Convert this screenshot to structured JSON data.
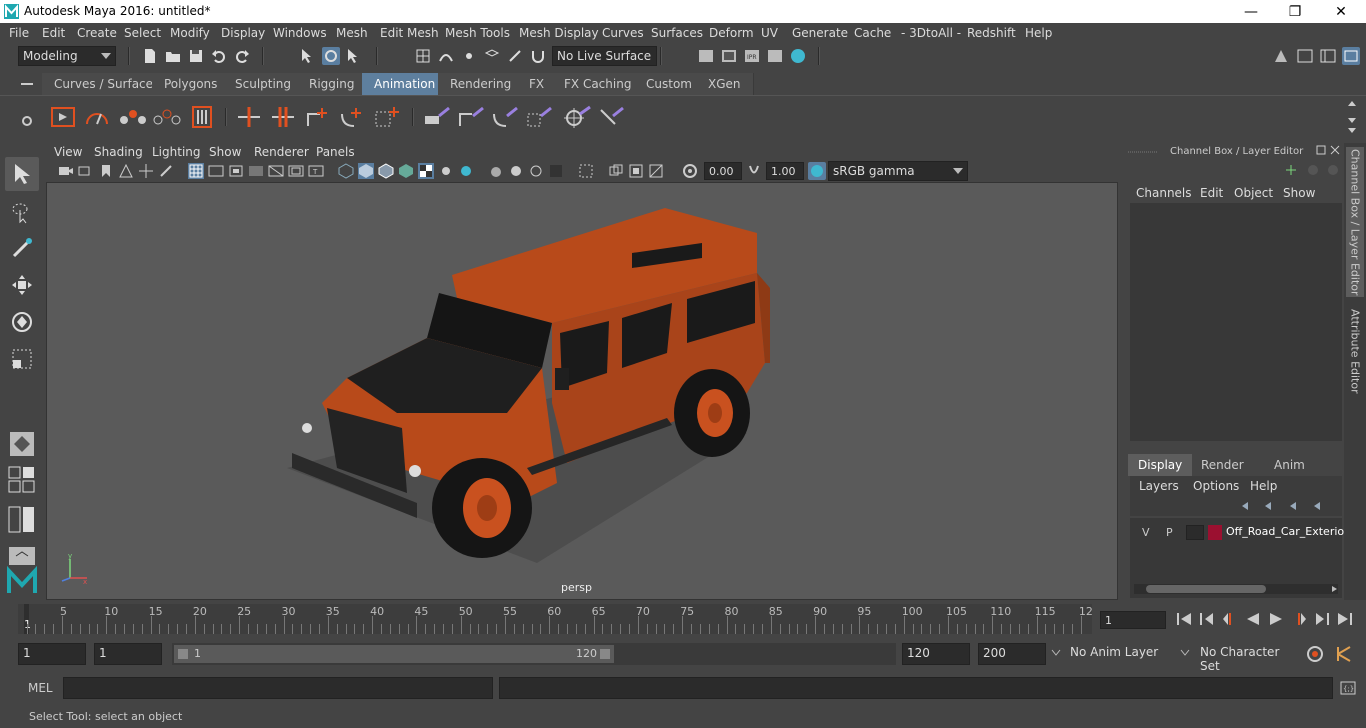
{
  "window": {
    "title": "Autodesk Maya 2016: untitled*",
    "minimize": "—",
    "maximize": "❐",
    "close": "✕"
  },
  "menubar": [
    "File",
    "Edit",
    "Create",
    "Select",
    "Modify",
    "Display",
    "Windows",
    "Mesh",
    "Edit Mesh",
    "Mesh Tools",
    "Mesh Display",
    "Curves",
    "Surfaces",
    "Deform",
    "UV",
    "Generate",
    "Cache",
    "- 3DtoAll -",
    "Redshift",
    "Help"
  ],
  "statusline": {
    "mode": "Modeling",
    "live_surface": "No Live Surface"
  },
  "shelf_tabs": [
    "Curves / Surfaces",
    "Polygons",
    "Sculpting",
    "Rigging",
    "Animation",
    "Rendering",
    "FX",
    "FX Caching",
    "Custom",
    "XGen"
  ],
  "shelf_active": "Animation",
  "viewport": {
    "menu": [
      "View",
      "Shading",
      "Lighting",
      "Show",
      "Renderer",
      "Panels"
    ],
    "field_a": "0.00",
    "field_b": "1.00",
    "color_space": "sRGB gamma",
    "camera_label": "persp"
  },
  "channel_box": {
    "header": "Channel Box / Layer Editor",
    "menu": [
      "Channels",
      "Edit",
      "Object",
      "Show"
    ],
    "layer_tabs": [
      "Display",
      "Render",
      "Anim"
    ],
    "layer_menu": [
      "Layers",
      "Options",
      "Help"
    ],
    "layer": {
      "v": "V",
      "p": "P",
      "name": "Off_Road_Car_Exterior",
      "color": "#9b1030"
    }
  },
  "side_tabs": [
    "Channel Box / Layer Editor",
    "Attribute Editor"
  ],
  "timeline": {
    "ticks": [
      "5",
      "10",
      "15",
      "20",
      "25",
      "30",
      "35",
      "40",
      "45",
      "50",
      "55",
      "60",
      "65",
      "70",
      "75",
      "80",
      "85",
      "90",
      "95",
      "100",
      "105",
      "110",
      "115",
      "12"
    ],
    "start_marker": "1",
    "current_frame": "1"
  },
  "range": {
    "start": "1",
    "anim_start": "1",
    "slider_start": "1",
    "slider_end": "120",
    "end": "120",
    "anim_end": "200",
    "anim_layer": "No Anim Layer",
    "character_set": "No Character Set"
  },
  "cmdline": {
    "label": "MEL"
  },
  "helpline": "Select Tool: select an object",
  "colors": {
    "accent_tab": "#5e7f9e",
    "car_body": "#b84a1a",
    "viewport_bg": "#5a5a5a"
  }
}
